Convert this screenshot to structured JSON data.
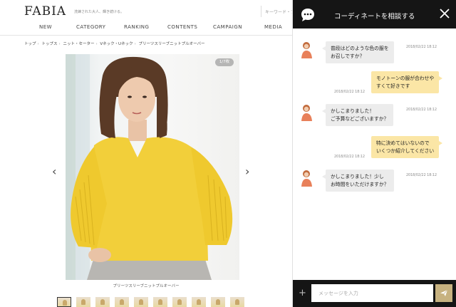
{
  "site": {
    "logo": "FABIA",
    "tagline": "洗練された大人、輝き続ける。",
    "search_placeholder": "キーワード・ブランド"
  },
  "nav": {
    "items": [
      "NEW",
      "CATEGORY",
      "RANKING",
      "CONTENTS",
      "CAMPAIGN",
      "MEDIA"
    ]
  },
  "breadcrumb": [
    "トップ",
    "トップス",
    "ニット・セーター",
    "Vネック・Uネック",
    "プリーツスリーブニットプルオーバー"
  ],
  "product": {
    "image_counter": "1/7枚",
    "caption": "プリーツスリーブニットプルオーバー",
    "prev_arrow": "‹",
    "next_arrow": "›",
    "thumbnail_count": 10
  },
  "chat": {
    "title": "コーディネートを相談する",
    "messages": [
      {
        "from": "staff",
        "lines": [
          "普段はどのような色の服を",
          "お召しですか？"
        ],
        "time": "2018/02/22 18:12"
      },
      {
        "from": "user",
        "lines": [
          "モノトーンの服が合わせや",
          "すくて好きです"
        ],
        "time": "2018/02/22 18:12"
      },
      {
        "from": "staff",
        "lines": [
          "かしこまりました！",
          "ご予算などございますか？"
        ],
        "time": "2018/02/22 18:12"
      },
      {
        "from": "user",
        "lines": [
          "特に決めてはいないので",
          "いくつか紹介してください"
        ],
        "time": "2018/02/22 18:12"
      },
      {
        "from": "staff",
        "lines": [
          "かしこまりました！少し",
          "お時間をいただけますか？"
        ],
        "time": "2018/02/22 18:12"
      }
    ],
    "input_placeholder": "メッセージを入力",
    "plus_label": "+"
  },
  "colors": {
    "chat_header_bg": "#151515",
    "user_bubble": "#fbe6a6",
    "staff_bubble": "#ececec",
    "send_button": "#c7b280",
    "product_yellow": "#f2cf3a"
  }
}
